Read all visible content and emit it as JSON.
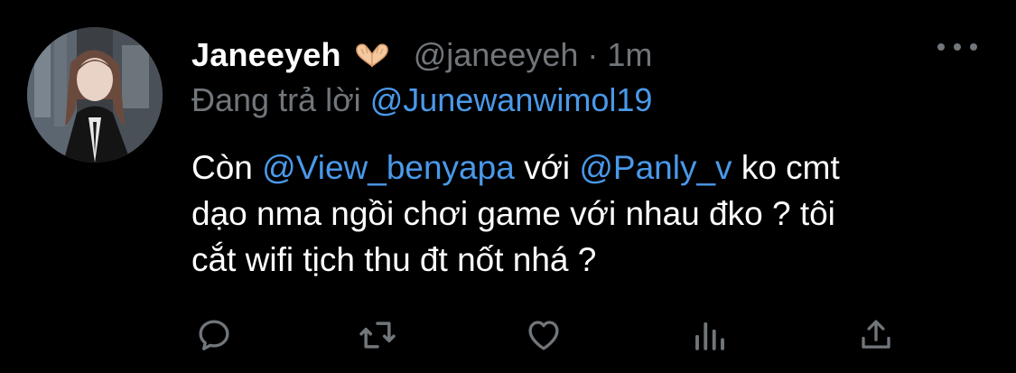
{
  "tweet": {
    "display_name": "Janeeyeh",
    "emoji_name": "heart-hands-emoji",
    "handle": "@janeeyeh",
    "separator": "·",
    "time": "1m",
    "reply_prefix": "Đang trả lời",
    "reply_to": "@Junewanwimol19",
    "body": {
      "line1_a": "Còn ",
      "mention1": "@View_benyapa",
      "line1_b": " với ",
      "mention2": "@Panly_v",
      "line1_c": " ko cmt",
      "line2": "dạo nma ngồi chơi game với nhau đko ?  tôi",
      "line3": "cắt wifi tịch thu đt nốt nhá ?"
    },
    "actions": [
      {
        "icon": "reply-icon"
      },
      {
        "icon": "retweet-icon"
      },
      {
        "icon": "like-icon"
      },
      {
        "icon": "analytics-icon"
      },
      {
        "icon": "share-icon"
      }
    ]
  },
  "colors": {
    "background": "#000000",
    "text_primary": "#ffffff",
    "text_secondary": "#71767b",
    "link": "#4a99e9"
  }
}
